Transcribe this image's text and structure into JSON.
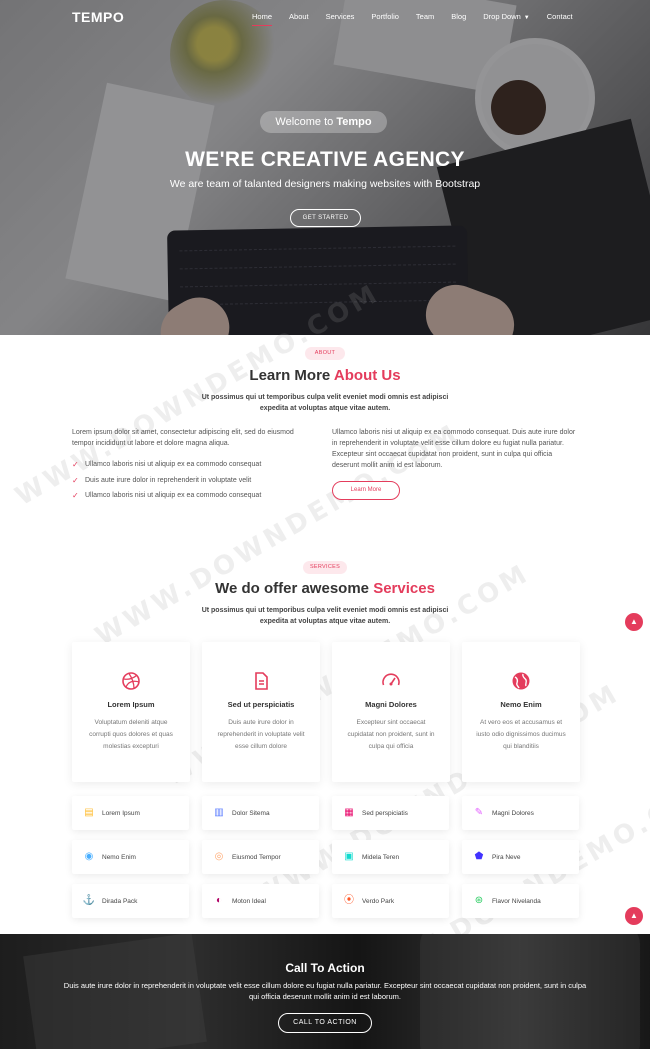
{
  "brand": "TEMPO",
  "nav": {
    "items": [
      "Home",
      "About",
      "Services",
      "Portfolio",
      "Team",
      "Blog",
      "Drop Down",
      "Contact"
    ],
    "active": "Home"
  },
  "hero": {
    "welcome_prefix": "Welcome to",
    "welcome_brand": "Tempo",
    "title": "WE'RE CREATIVE AGENCY",
    "subtitle": "We are team of talanted designers making websites with Bootstrap",
    "cta": "GET STARTED"
  },
  "about": {
    "tag": "ABOUT",
    "title_plain": "Learn More",
    "title_accent": "About Us",
    "subtitle": "Ut possimus qui ut temporibus culpa velit eveniet modi omnis est adipisci expedita at voluptas atque vitae autem.",
    "left_text": "Lorem ipsum dolor sit amet, consectetur adipiscing elit, sed do eiusmod tempor incididunt ut labore et dolore magna aliqua.",
    "list": [
      "Ullamco laboris nisi ut aliquip ex ea commodo consequat",
      "Duis aute irure dolor in reprehenderit in voluptate velit",
      "Ullamco laboris nisi ut aliquip ex ea commodo consequat"
    ],
    "right_text": "Ullamco laboris nisi ut aliquip ex ea commodo consequat. Duis aute irure dolor in reprehenderit in voluptate velit esse cillum dolore eu fugiat nulla pariatur. Excepteur sint occaecat cupidatat non proident, sunt in culpa qui officia deserunt mollit anim id est laborum.",
    "button": "Learn More"
  },
  "services": {
    "tag": "SERVICES",
    "title_plain": "We do offer awesome",
    "title_accent": "Services",
    "subtitle": "Ut possimus qui ut temporibus culpa velit eveniet modi omnis est adipisci expedita at voluptas atque vitae autem.",
    "cards": [
      {
        "icon": "dribbble-icon",
        "title": "Lorem Ipsum",
        "desc": "Voluptatum deleniti atque corrupti quos dolores et quas molestias excepturi"
      },
      {
        "icon": "file-icon",
        "title": "Sed ut perspiciatis",
        "desc": "Duis aute irure dolor in reprehenderit in voluptate velit esse cillum dolore"
      },
      {
        "icon": "tachometer-icon",
        "title": "Magni Dolores",
        "desc": "Excepteur sint occaecat cupidatat non proident, sunt in culpa qui officia"
      },
      {
        "icon": "globe-icon",
        "title": "Nemo Enim",
        "desc": "At vero eos et accusamus et iusto odio dignissimos ducimus qui blanditiis"
      }
    ],
    "features": [
      {
        "icon": "store-icon",
        "color": "#ffbb2c",
        "label": "Lorem Ipsum"
      },
      {
        "icon": "bar-chart-icon",
        "color": "#5578ff",
        "label": "Dolor Sitema"
      },
      {
        "icon": "calendar-icon",
        "color": "#e80368",
        "label": "Sed perspiciatis"
      },
      {
        "icon": "paint-brush-icon",
        "color": "#e361ff",
        "label": "Magni Dolores"
      },
      {
        "icon": "database-icon",
        "color": "#47aeff",
        "label": "Nemo Enim"
      },
      {
        "icon": "gradienter-icon",
        "color": "#ffa76e",
        "label": "Eiusmod Tempor"
      },
      {
        "icon": "file-list-icon",
        "color": "#11dbcf",
        "label": "Midela Teren"
      },
      {
        "icon": "price-tag-icon",
        "color": "#4233ff",
        "label": "Pira Neve"
      },
      {
        "icon": "anchor-icon",
        "color": "#b2904f",
        "label": "Dirada Pack"
      },
      {
        "icon": "disc-icon",
        "color": "#b20969",
        "label": "Moton Ideal"
      },
      {
        "icon": "base-station-icon",
        "color": "#ff5828",
        "label": "Verdo Park"
      },
      {
        "icon": "fingerprint-icon",
        "color": "#29cc61",
        "label": "Flavor Nivelanda"
      }
    ]
  },
  "cta": {
    "title": "Call To Action",
    "text": "Duis aute irure dolor in reprehenderit in voluptate velit esse cillum dolore eu fugiat nulla pariatur. Excepteur sint occaecat cupidatat non proident, sunt in culpa qui officia deserunt mollit anim id est laborum.",
    "button": "CALL TO ACTION"
  },
  "watermark": "WWW.DOWNDEMO.COM",
  "colors": {
    "accent": "#e43c5c"
  }
}
